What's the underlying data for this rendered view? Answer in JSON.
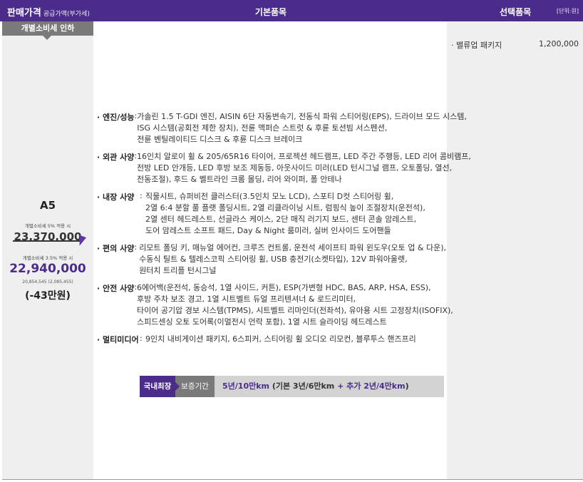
{
  "header": {
    "sale_price": "판매가격",
    "sale_price_note": "공급가액(부가세)",
    "basic_items": "기본품목",
    "option_items": "선택품목",
    "unit": "[단위:원]"
  },
  "discount_tab": "개별소비세 인하",
  "trim": {
    "name": "A5",
    "tax5_label": "개별소비세 5% 적용 시",
    "price_old": "23,370,000",
    "tax35_label": "개별소비세 3.5% 적용 시",
    "price_new": "22,940,000",
    "price_sub": "20,854,545 (2,085,455)",
    "price_diff": "(-43만원)"
  },
  "features": [
    {
      "label": "· 엔진/성능",
      "lines": [
        "가솔린 1.5 T-GDI 엔진, AISIN 6단 자동변속기, 전동식 파워 스티어링(EPS), 드라이브 모드 시스템,",
        "ISG 시스템(공회전 제한 장치), 전륜 맥퍼슨 스트럿 & 후륜 토션빔 서스펜션,",
        "전륜 벤틸레이티드 디스크 & 후륜 디스크 브레이크"
      ]
    },
    {
      "label": "· 외관 사양",
      "lines": [
        "16인치 알로이 휠 & 205/65R16 타이어, 프로젝션 헤드램프, LED 주간 주행등, LED 리어 콤비램프,",
        "전방 LED 안개등, LED 후방 보조 제동등, 아웃사이드 미러(LED 턴시그널 램프, 오토폴딩, 열선,",
        "전동조절), 후드 & 벨트라인 크롬 몰딩, 리어 와이퍼, 폴 안테나"
      ]
    },
    {
      "label": "· 내장 사양",
      "lines": [
        "직물시트, 슈퍼비전 클러스터(3.5인치 모노 LCD), 스포티 D컷 스티어링 휠,",
        "2열 6:4 분할 풀 플랫 폴딩시트, 2열 리클라이닝 시트, 럼핑식 높이 조절장치(운전석),",
        "2열 센터 헤드레스트, 선글라스 케이스, 2단 매직 러기지 보드, 센터 콘솔 암레스트,",
        "도어 암레스트 소프트 패드, Day & Night 룸미러, 실버 인사이드 도어핸들"
      ]
    },
    {
      "label": "· 편의 사양",
      "lines": [
        "리모트 폴딩 키, 매뉴얼 에어컨, 크루즈 컨트롤, 운전석 세이프티 파워 윈도우(오토 업 & 다운),",
        "수동식 틸트 & 텔레스코픽 스티어링 휠, USB 충전기(소켓타입), 12V 파워아울렛,",
        "원터치 트리플 턴시그널"
      ]
    },
    {
      "label": "· 안전 사양",
      "lines": [
        "6에어백(운전석, 동승석, 1열 사이드, 커튼), ESP(가변형 HDC, BAS, ARP, HSA, ESS),",
        "후방 주차 보조 경고, 1열 시트벨트 듀얼 프리텐셔너 & 로드리미터,",
        "타이어 공기압 경보 시스템(TPMS), 시트벨트 리마인더(전좌석), 유아용 시트 고정장치(ISOFIX),",
        "스피드센싱 오토 도어록(이멀전시 언락 포함), 1열 시트 슬라이딩 헤드레스트"
      ]
    },
    {
      "label": "· 멀티미디어",
      "lines": [
        "9인치 내비게이션 패키지, 6스피커, 스티어링 휠 오디오 리모컨, 블루투스 핸즈프리"
      ]
    }
  ],
  "warranty": {
    "tag1": "국내최장",
    "tag2": "보증기간",
    "part1": "5년/10만km",
    "part2": " (기본 3년/6만km ",
    "part3": "+ 추가 2년/4만km",
    "part4": ")"
  },
  "option_package": {
    "name": "· 밸류업 패키지",
    "price": "1,200,000"
  },
  "colors": {
    "header": "#4b2c8a",
    "accent": "#4b2c8a",
    "column_bg": "#efefef"
  }
}
